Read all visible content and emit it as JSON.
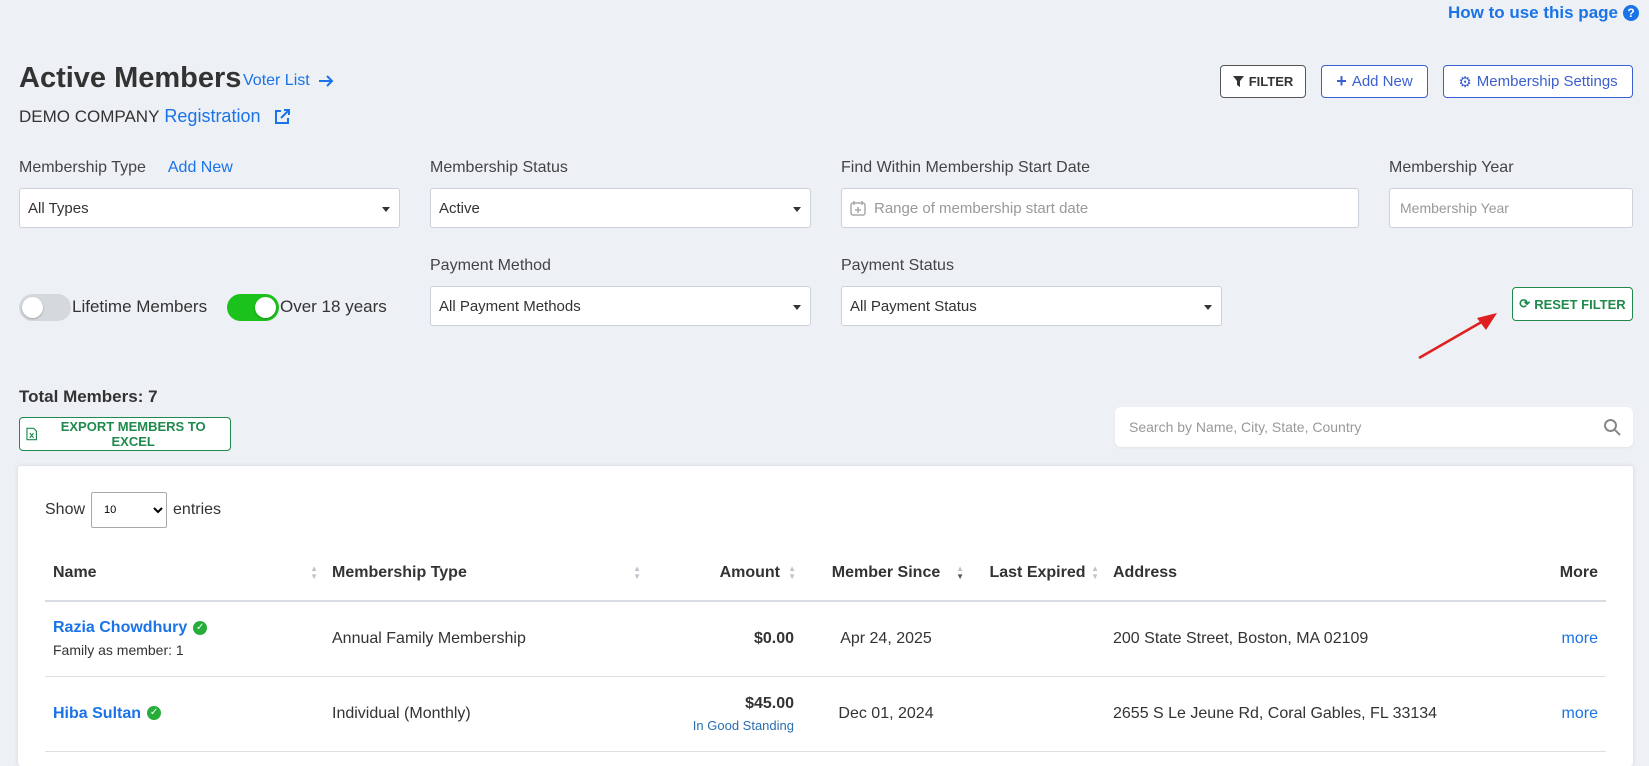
{
  "help": {
    "label": "How to use this page"
  },
  "header": {
    "title": "Active Members",
    "voter_link": "Voter List",
    "company": "DEMO COMPANY",
    "registration": "Registration"
  },
  "toolbar": {
    "filter_label": "FILTER",
    "add_new_label": "Add New",
    "settings_label": "Membership Settings"
  },
  "filters": {
    "membership_type": {
      "label": "Membership Type",
      "add_new": "Add New",
      "value": "All Types"
    },
    "membership_status": {
      "label": "Membership Status",
      "value": "Active"
    },
    "start_date": {
      "label": "Find Within Membership Start Date",
      "placeholder": "Range of membership start date"
    },
    "membership_year": {
      "label": "Membership Year",
      "placeholder": "Membership Year"
    },
    "payment_method": {
      "label": "Payment Method",
      "value": "All Payment Methods"
    },
    "payment_status": {
      "label": "Payment Status",
      "value": "All Payment Status"
    },
    "lifetime_toggle": {
      "label": "Lifetime Members",
      "on": false
    },
    "over18_toggle": {
      "label": "Over 18 years",
      "on": true
    },
    "reset_label": "RESET FILTER"
  },
  "summary": {
    "total": "Total Members: 7",
    "export_label": "EXPORT MEMBERS TO EXCEL",
    "search_placeholder": "Search by Name, City, State, Country"
  },
  "table": {
    "show_label": "Show",
    "entries_label": "entries",
    "page_size": "10",
    "columns": {
      "name": "Name",
      "type": "Membership Type",
      "amount": "Amount",
      "since": "Member Since",
      "expired": "Last Expired",
      "address": "Address",
      "more": "More"
    },
    "rows": [
      {
        "name": "Razia Chowdhury",
        "sub": "Family as member: 1",
        "type": "Annual Family Membership",
        "amount": "$0.00",
        "standing": "",
        "since": "Apr 24, 2025",
        "expired": "",
        "address": "200 State Street, Boston, MA 02109",
        "more": "more"
      },
      {
        "name": "Hiba Sultan",
        "sub": "",
        "type": "Individual (Monthly)",
        "amount": "$45.00",
        "standing": "In Good Standing",
        "since": "Dec 01, 2024",
        "expired": "",
        "address": "2655 S Le Jeune Rd, Coral Gables, FL 33134",
        "more": "more"
      }
    ]
  },
  "colors": {
    "accent": "#1a73e8",
    "success": "#1f8a4c",
    "toggle_on": "#1cc21c",
    "annotation_arrow": "#e02020"
  }
}
